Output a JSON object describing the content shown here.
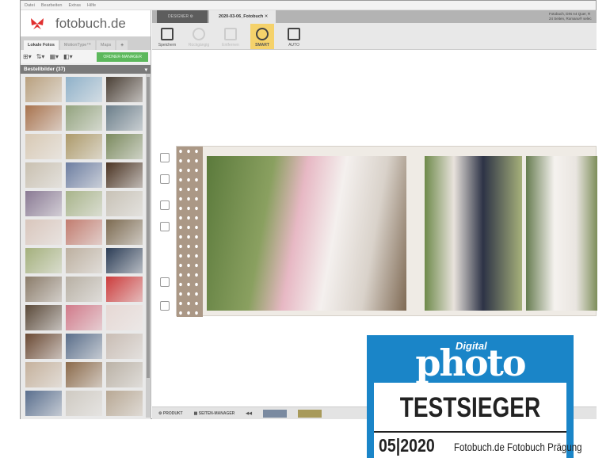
{
  "menu": [
    "Datei",
    "Bearbeiten",
    "Extras",
    "Hilfe"
  ],
  "logo": "fotobuch.de",
  "left_tabs": [
    "Lokale Fotos",
    "MotionType™",
    "Maps",
    "♣"
  ],
  "organizer_button": "ORDNER-MANAGER",
  "bestell_header": "Bestellbilder (37)",
  "thumb_colors": [
    "#b9a07e",
    "#8fb1c9",
    "#4b4036",
    "#a8734e",
    "#93a37e",
    "#6b7e8a",
    "#d8c9b4",
    "#ad9a6a",
    "#7b8a5e",
    "#c9c0b0",
    "#6d7ea1",
    "#4b3423",
    "#8a7a94",
    "#a8b48a",
    "#c8c2b6",
    "#d9c6bc",
    "#c27c6f",
    "#7c6a50",
    "#a4b07c",
    "#bdb0a0",
    "#2c3d56",
    "#8b7c6a",
    "#b8b0a4",
    "#cc3c3c",
    "#5b4a3a",
    "#d17a8a",
    "#e6d8d4",
    "#6b4a34",
    "#5a6e8a",
    "#c9bdb4",
    "#c5b19c",
    "#8b6a4a",
    "#bbb2a6",
    "#5a6f8e",
    "#cfcac2",
    "#b8a894"
  ],
  "doc_tabs": {
    "designer": "DESIGNER",
    "project": "2020-03-06_Fotobuch"
  },
  "product_info": [
    "Fotobuch, DIN A4 Quer, R",
    "24 Seiten, Romanu® selec"
  ],
  "toolbar": [
    "Speichern",
    "Rückgängig",
    "Entfernen",
    "SMART",
    "AUTO"
  ],
  "bottom": {
    "product": "PRODUKT",
    "pages": "SEITEN-MANAGER",
    "nav": "◀◀"
  },
  "badge": {
    "digital": "Digital",
    "photo": "photo",
    "title": "TESTSIEGER",
    "issue": "05|2020",
    "product": "Fotobuch.de Fotobuch Prägung",
    "accent": "#1a85c8"
  }
}
